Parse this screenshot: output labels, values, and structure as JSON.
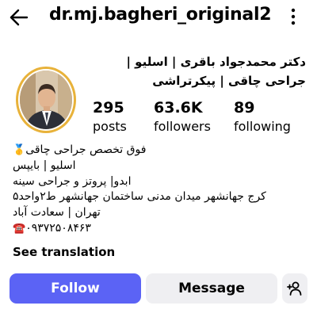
{
  "header": {
    "username": "dr.mj.bagheri_original2",
    "back_icon": "arrow-left-icon",
    "more_icon": "kebab-vertical-icon"
  },
  "profile": {
    "full_name": "دکتر محمدجواد باقری | اسلیو | جراحی چاقی | پیکرتراشی",
    "avatar_ring_color": "#e8b23a"
  },
  "stats": {
    "posts": {
      "count": "295",
      "label": "posts"
    },
    "followers": {
      "count": "63.6K",
      "label": "followers"
    },
    "following": {
      "count": "89",
      "label": "following"
    }
  },
  "bio": {
    "line1_text": "فوق تخصص جراحی چاقی",
    "line1_icon": "🥇",
    "line2": "اسلیو | بایپس",
    "line3": "ابدو| پروتز و جراحی سینه",
    "line4": "کرج جهانشهر میدان مدنی ساختمان جهانشهر ط۲واحد۵",
    "line5": "تهران | سعادت آباد",
    "line6_icon": "☎️",
    "line6_text": "۰۹۳۷۲۵۰۸۴۶۳",
    "see_translation": "See translation"
  },
  "actions": {
    "follow_label": "Follow",
    "message_label": "Message",
    "suggest_icon": "add-person-icon",
    "follow_color": "#5b63f5",
    "secondary_color": "#efeff2"
  }
}
